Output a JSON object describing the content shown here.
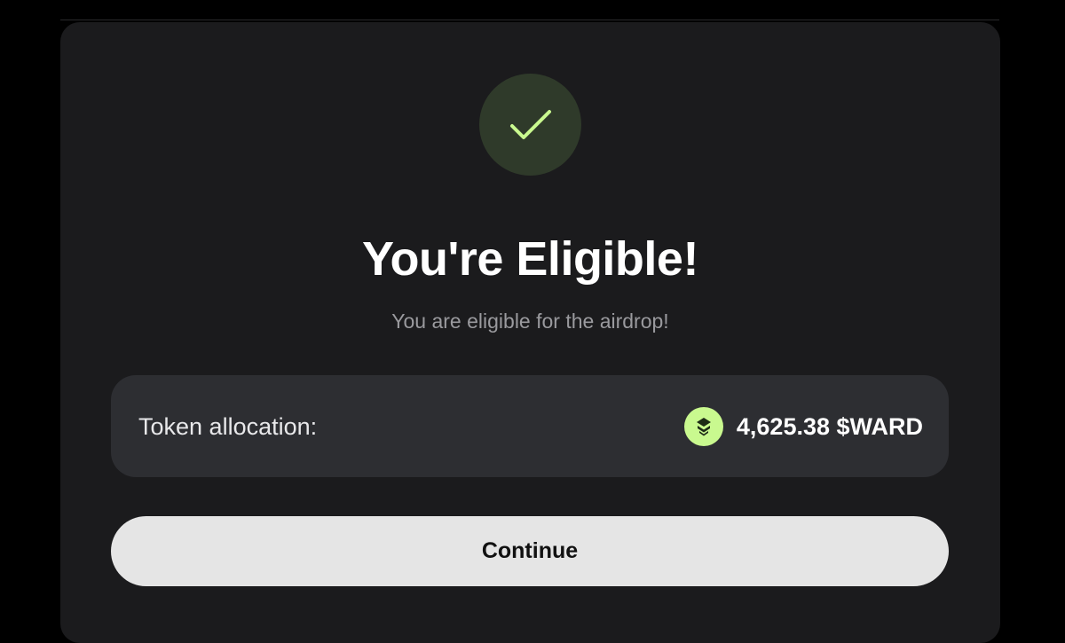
{
  "modal": {
    "title": "You're Eligible!",
    "subtitle": "You are eligible for the airdrop!",
    "status_icon": "checkmark-icon",
    "allocation": {
      "label": "Token allocation:",
      "amount": "4,625.38 $WARD",
      "token_icon": "ward-token-icon"
    },
    "continue_label": "Continue"
  },
  "colors": {
    "background": "#000000",
    "modal_bg": "#1b1b1d",
    "accent_green": "#c9f98f",
    "badge_bg": "#2f3a2a",
    "card_bg": "#2d2e32",
    "button_bg": "#e5e5e5"
  }
}
